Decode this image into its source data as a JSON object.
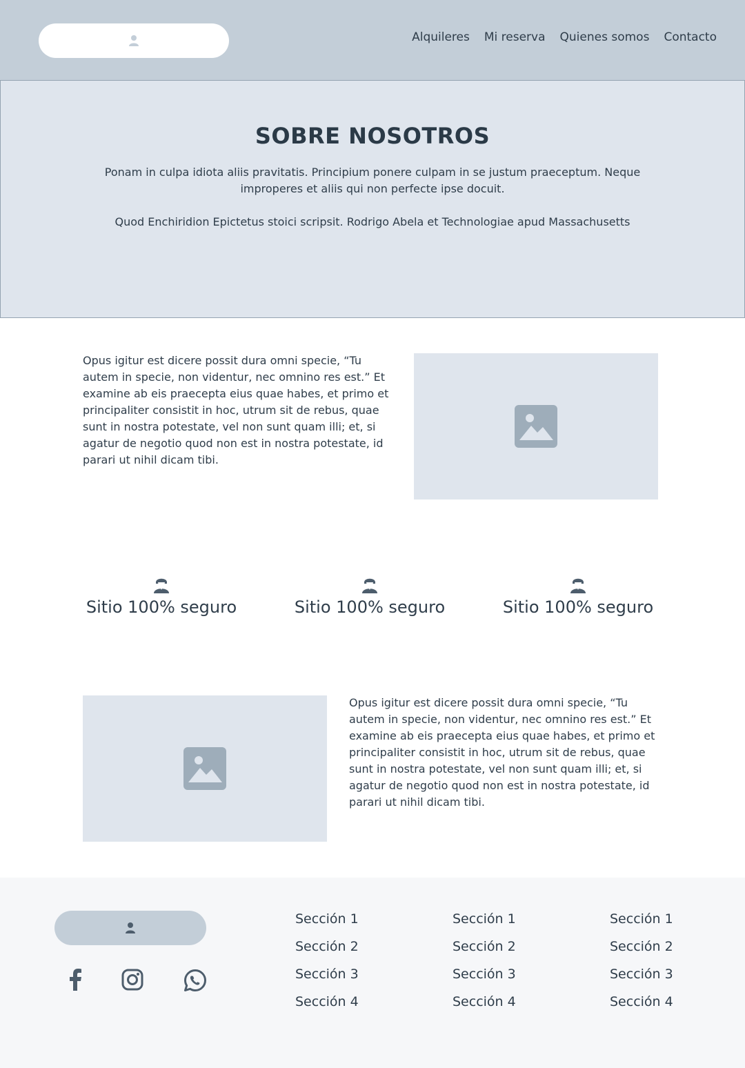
{
  "header": {
    "nav": [
      "Alquileres",
      "Mi reserva",
      "Quienes somos",
      "Contacto"
    ]
  },
  "hero": {
    "title": "SOBRE NOSOTROS",
    "text1": "Ponam in culpa idiota aliis pravitatis. Principium ponere culpam in se justum praeceptum. Neque improperes et aliis qui non perfecte ipse docuit.",
    "text2": "Quod Enchiridion Epictetus stoici scripsit. Rodrigo Abela et Technologiae apud Massachusetts"
  },
  "section1": {
    "paragraph": "Opus igitur est dicere possit dura omni specie, “Tu autem in specie, non videntur, nec omnino res est.” Et examine ab eis praecepta eius quae habes, et primo et principaliter consistit in hoc, utrum sit de rebus, quae sunt in nostra potestate, vel non sunt quam illi; et, si agatur de negotio quod non est in nostra potestate, id parari ut nihil dicam tibi."
  },
  "features": [
    {
      "label": "Sitio 100% seguro",
      "icon": "person-icon"
    },
    {
      "label": "Sitio 100% seguro",
      "icon": "person-icon"
    },
    {
      "label": "Sitio 100% seguro",
      "icon": "person-icon"
    }
  ],
  "section2": {
    "paragraph": "Opus igitur est dicere possit dura omni specie, “Tu autem in specie, non videntur, nec omnino res est.” Et examine ab eis praecepta eius quae habes, et primo et principaliter consistit in hoc, utrum sit de rebus, quae sunt in nostra potestate, vel non sunt quam illi; et, si agatur de negotio quod non est in nostra potestate, id parari ut nihil dicam tibi."
  },
  "footer": {
    "columns": [
      [
        "Sección 1",
        "Sección 2",
        "Sección 3",
        "Sección 4"
      ],
      [
        "Sección 1",
        "Sección 2",
        "Sección 3",
        "Sección 4"
      ],
      [
        "Sección 1",
        "Sección 2",
        "Sección 3",
        "Sección 4"
      ]
    ],
    "social": [
      "facebook-icon",
      "instagram-icon",
      "whatsapp-icon"
    ]
  },
  "colors": {
    "header_bg": "#c3ced8",
    "hero_bg": "#dfe5ed",
    "text": "#2f3d4a",
    "icon": "#4d5d6c",
    "placeholder_icon": "#9eadba",
    "footer_bg": "#f6f7f9"
  }
}
